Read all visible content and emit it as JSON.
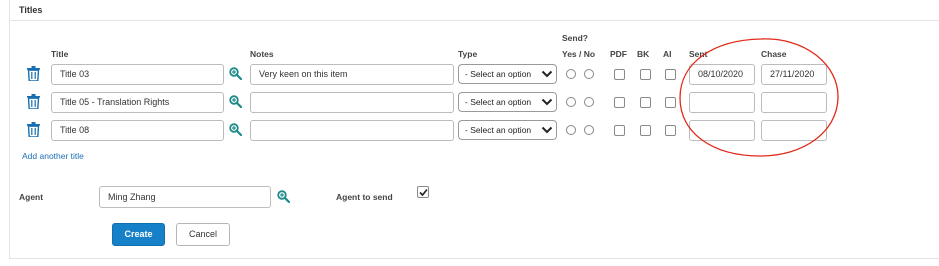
{
  "section": {
    "title": "Titles"
  },
  "columns": {
    "send_group": "Send?",
    "title": "Title",
    "notes": "Notes",
    "type": "Type",
    "yes_no": "Yes / No",
    "pdf": "PDF",
    "bk": "BK",
    "ai": "AI",
    "sent": "Sent",
    "chase": "Chase"
  },
  "rows": [
    {
      "title": "Title 03",
      "notes": "Very keen on this item",
      "type": "- Select an option",
      "sent": "08/10/2020",
      "chase": "27/11/2020"
    },
    {
      "title": "Title 05 - Translation Rights",
      "notes": "",
      "type": "- Select an option",
      "sent": "",
      "chase": ""
    },
    {
      "title": "Title 08",
      "notes": "",
      "type": "- Select an option",
      "sent": "",
      "chase": ""
    }
  ],
  "add_title_link": "Add another title",
  "agent": {
    "label": "Agent",
    "value": "Ming Zhang",
    "send_label": "Agent to send",
    "send_checked": true
  },
  "buttons": {
    "create": "Create",
    "cancel": "Cancel"
  },
  "icons": {
    "delete": "trash-icon",
    "lookup": "magnify-plus-icon",
    "dropdown": "chevron-down-icon"
  },
  "colors": {
    "accent": "#1681c8",
    "link": "#1d6fb8",
    "annotation": "#e02a1a",
    "icon": "#1a6fb0",
    "lookup_icon": "#1f8a8a"
  }
}
